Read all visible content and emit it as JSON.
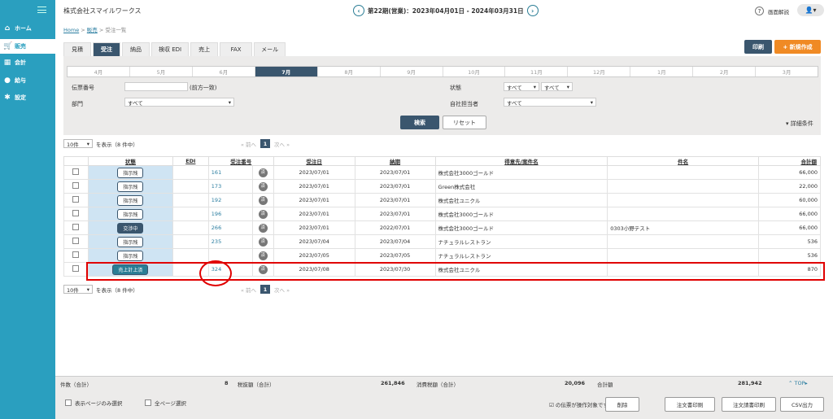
{
  "sidebar": {
    "items": [
      {
        "label": "ホーム",
        "icon": "home-icon"
      },
      {
        "label": "販売",
        "icon": "cart-icon"
      },
      {
        "label": "会計",
        "icon": "calculator-icon"
      },
      {
        "label": "給与",
        "icon": "moneybag-icon"
      },
      {
        "label": "設定",
        "icon": "gear-icon"
      }
    ]
  },
  "header": {
    "company": "株式会社スマイルワークス",
    "period": "第22期(営業)：2023年04月01日 - 2024年03月31日",
    "help": "画面解説"
  },
  "breadcrumb": {
    "home": "Home",
    "sales": "販売",
    "current": "受注一覧"
  },
  "tabs": [
    "見積",
    "受注",
    "納品",
    "検収 EDI",
    "売上",
    "FAX",
    "メール"
  ],
  "actions": {
    "print": "印刷",
    "new": "+ 新規作成"
  },
  "months": [
    "4月",
    "5月",
    "6月",
    "7月",
    "8月",
    "9月",
    "10月",
    "11月",
    "12月",
    "1月",
    "2月",
    "3月"
  ],
  "filter": {
    "slip_label": "伝票番号",
    "slip_hint": "(前方一致)",
    "dept_label": "部門",
    "dept_value": "すべて",
    "status_label": "状態",
    "status_v1": "すべて",
    "status_v2": "すべて",
    "staff_label": "自社担当者",
    "staff_value": "すべて",
    "search": "検索",
    "reset": "リセット",
    "detail": "詳細条件"
  },
  "pager": {
    "per_page": "10件",
    "showing": "を表示（8 件中）",
    "prev": "前へ",
    "page": "1",
    "next": "次へ"
  },
  "table": {
    "headers": [
      "状態",
      "EDI",
      "受注番号",
      "受注日",
      "納期",
      "得意先/案件名",
      "件名",
      "合計額"
    ],
    "rows": [
      {
        "status": "指示残",
        "num": "161",
        "date": "2023/07/01",
        "due": "2023/07/01",
        "client": "株式会社3000ゴールド",
        "subject": "",
        "total": "66,000"
      },
      {
        "status": "指示残",
        "num": "173",
        "date": "2023/07/01",
        "due": "2023/07/01",
        "client": "Green株式会社",
        "subject": "",
        "total": "22,000"
      },
      {
        "status": "指示残",
        "num": "192",
        "date": "2023/07/01",
        "due": "2023/07/01",
        "client": "株式会社ユニクル",
        "subject": "",
        "total": "60,000"
      },
      {
        "status": "指示残",
        "num": "196",
        "date": "2023/07/01",
        "due": "2023/07/01",
        "client": "株式会社3000ゴールド",
        "subject": "",
        "total": "66,000"
      },
      {
        "status": "交渉中",
        "num": "266",
        "date": "2023/07/01",
        "due": "2022/07/01",
        "client": "株式会社3000ゴールド",
        "subject": "0303小野テスト",
        "total": "66,000"
      },
      {
        "status": "指示残",
        "num": "235",
        "date": "2023/07/04",
        "due": "2023/07/04",
        "client": "ナチュラルレストラン",
        "subject": "",
        "total": "536"
      },
      {
        "status": "指示残",
        "num": "",
        "date": "2023/07/05",
        "due": "2023/07/05",
        "client": "ナチュラルレストラン",
        "subject": "",
        "total": "536"
      },
      {
        "status": "売上計上済",
        "num": "324",
        "date": "2023/07/08",
        "due": "2023/07/30",
        "client": "株式会社ユニクル",
        "subject": "",
        "total": "870"
      }
    ],
    "mark": "済"
  },
  "footer": {
    "count_label": "件数（合計）",
    "count": "8",
    "excl_label": "税抜額（合計）",
    "excl": "261,846",
    "tax_label": "消費税額（合計）",
    "tax": "20,096",
    "total_label": "合計額",
    "total": "281,942",
    "top": "TOP",
    "sel_page": "表示ページのみ選択",
    "sel_all": "全ページ選択",
    "target": "の伝票が操作対象です。",
    "delete": "削除",
    "order_print": "注文書印刷",
    "ack_print": "注文請書印刷",
    "csv": "CSV出力"
  }
}
